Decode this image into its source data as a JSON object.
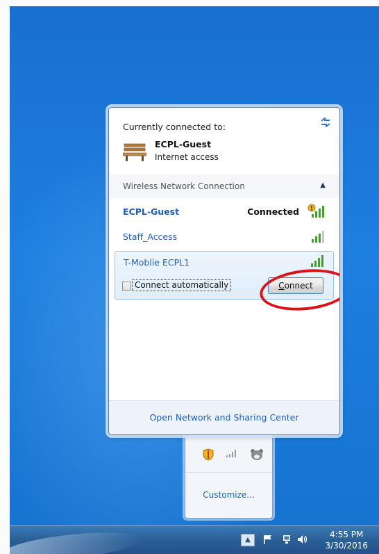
{
  "flyout": {
    "currently_connected_label": "Currently connected to:",
    "current_network": {
      "name": "ECPL-Guest",
      "status": "Internet access"
    },
    "section_label": "Wireless Network Connection",
    "networks": [
      {
        "name": "ECPL-Guest",
        "state": "Connected"
      },
      {
        "name": "Staff_Access",
        "state": ""
      },
      {
        "name": "T-Moblie ECPL1",
        "state": ""
      }
    ],
    "connect_automatically_label": "Connect automatically",
    "connect_automatically_checked": false,
    "connect_button_underlined": "C",
    "connect_button_rest": "onnect",
    "footer_link": "Open Network and Sharing Center"
  },
  "overflow_tray": {
    "icons": [
      "security-shield-icon",
      "wifi-signal-icon",
      "bear-app-icon"
    ],
    "customize_label": "Customize..."
  },
  "taskbar": {
    "tray_icons": [
      "show-hidden-icons-icon",
      "action-center-flag-icon",
      "network-icon",
      "volume-icon"
    ],
    "time": "4:55 PM",
    "date": "3/30/2016"
  },
  "colors": {
    "link_blue": "#1f5fb4",
    "annotation_red": "#d8141a",
    "signal_green": "#3fa02a"
  }
}
